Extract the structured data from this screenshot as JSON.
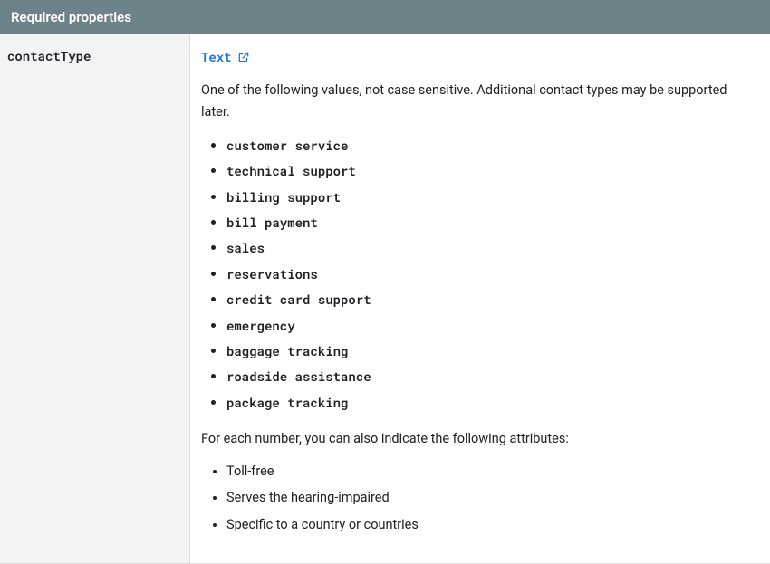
{
  "header": {
    "title": "Required properties"
  },
  "property": {
    "name": "contactType",
    "typeLink": "Text",
    "description": "One of the following values, not case sensitive. Additional contact types may be supported later.",
    "values": [
      "customer service",
      "technical support",
      "billing support",
      "bill payment",
      "sales",
      "reservations",
      "credit card support",
      "emergency",
      "baggage tracking",
      "roadside assistance",
      "package tracking"
    ],
    "attrIntro": "For each number, you can also indicate the following attributes:",
    "attributes": [
      "Toll-free",
      "Serves the hearing-impaired",
      "Specific to a country or countries"
    ]
  }
}
